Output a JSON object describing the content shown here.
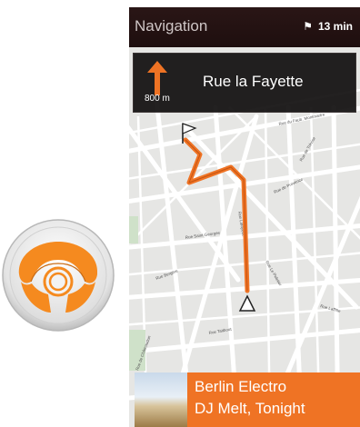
{
  "header": {
    "title": "Navigation",
    "eta": "13 min",
    "eta_icon": "flag-icon"
  },
  "turn": {
    "distance": "800 m",
    "street": "Rue la Fayette",
    "icon": "arrow-up-icon"
  },
  "map": {
    "street_labels": [
      "Rue du Faub. Montmartre",
      "Rue de Provence",
      "Rue Saint-Georges",
      "Rue Taitbout",
      "Rue Lafayette",
      "Rue de Châteaudun",
      "Rue Le Peletier",
      "Rue Laffitte",
      "Rue de Trévise",
      "Rue Bergère"
    ],
    "route_color": "#ef7324",
    "start_icon": "navigation-arrow-icon",
    "destination_icon": "destination-flag-icon"
  },
  "event": {
    "line1": "Berlin Electro",
    "line2": "DJ Melt, Tonight"
  },
  "badge": {
    "icon": "steering-wheel-icon",
    "accent": "#f58a1f"
  }
}
